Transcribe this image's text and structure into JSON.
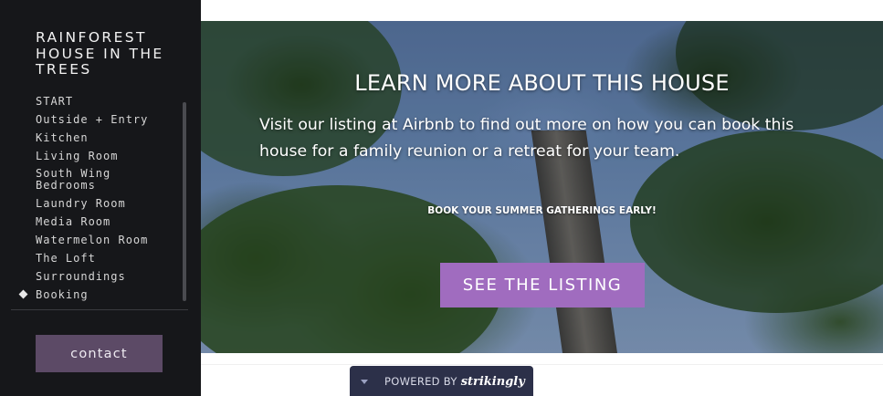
{
  "sidebar": {
    "title": "RAINFOREST HOUSE IN THE TREES",
    "items": [
      {
        "label": "START"
      },
      {
        "label": "Outside + Entry"
      },
      {
        "label": "Kitchen"
      },
      {
        "label": "Living Room"
      },
      {
        "label": "South Wing Bedrooms"
      },
      {
        "label": "Laundry Room"
      },
      {
        "label": "Media Room"
      },
      {
        "label": "Watermelon Room"
      },
      {
        "label": "The Loft"
      },
      {
        "label": "Surroundings"
      },
      {
        "label": "Booking",
        "active": true
      }
    ],
    "contact_label": "contact"
  },
  "hero": {
    "title": "LEARN MORE ABOUT THIS HOUSE",
    "text": "Visit our listing at Airbnb to find out more on how you can book this house for a family reunion or a retreat for your team.",
    "subtitle": "BOOK YOUR SUMMER GATHERINGS EARLY!",
    "button_label": "SEE THE LISTING"
  },
  "footer": {
    "powered_by": "POWERED BY",
    "brand": "strikingly"
  },
  "colors": {
    "sidebar_bg": "#16171a",
    "contact_button": "#5c4a66",
    "listing_button": "#a06cbf",
    "powered_bar": "#2c3049"
  },
  "icons": {
    "active_marker": "diamond-icon",
    "powered_toggle": "caret-down-icon"
  }
}
